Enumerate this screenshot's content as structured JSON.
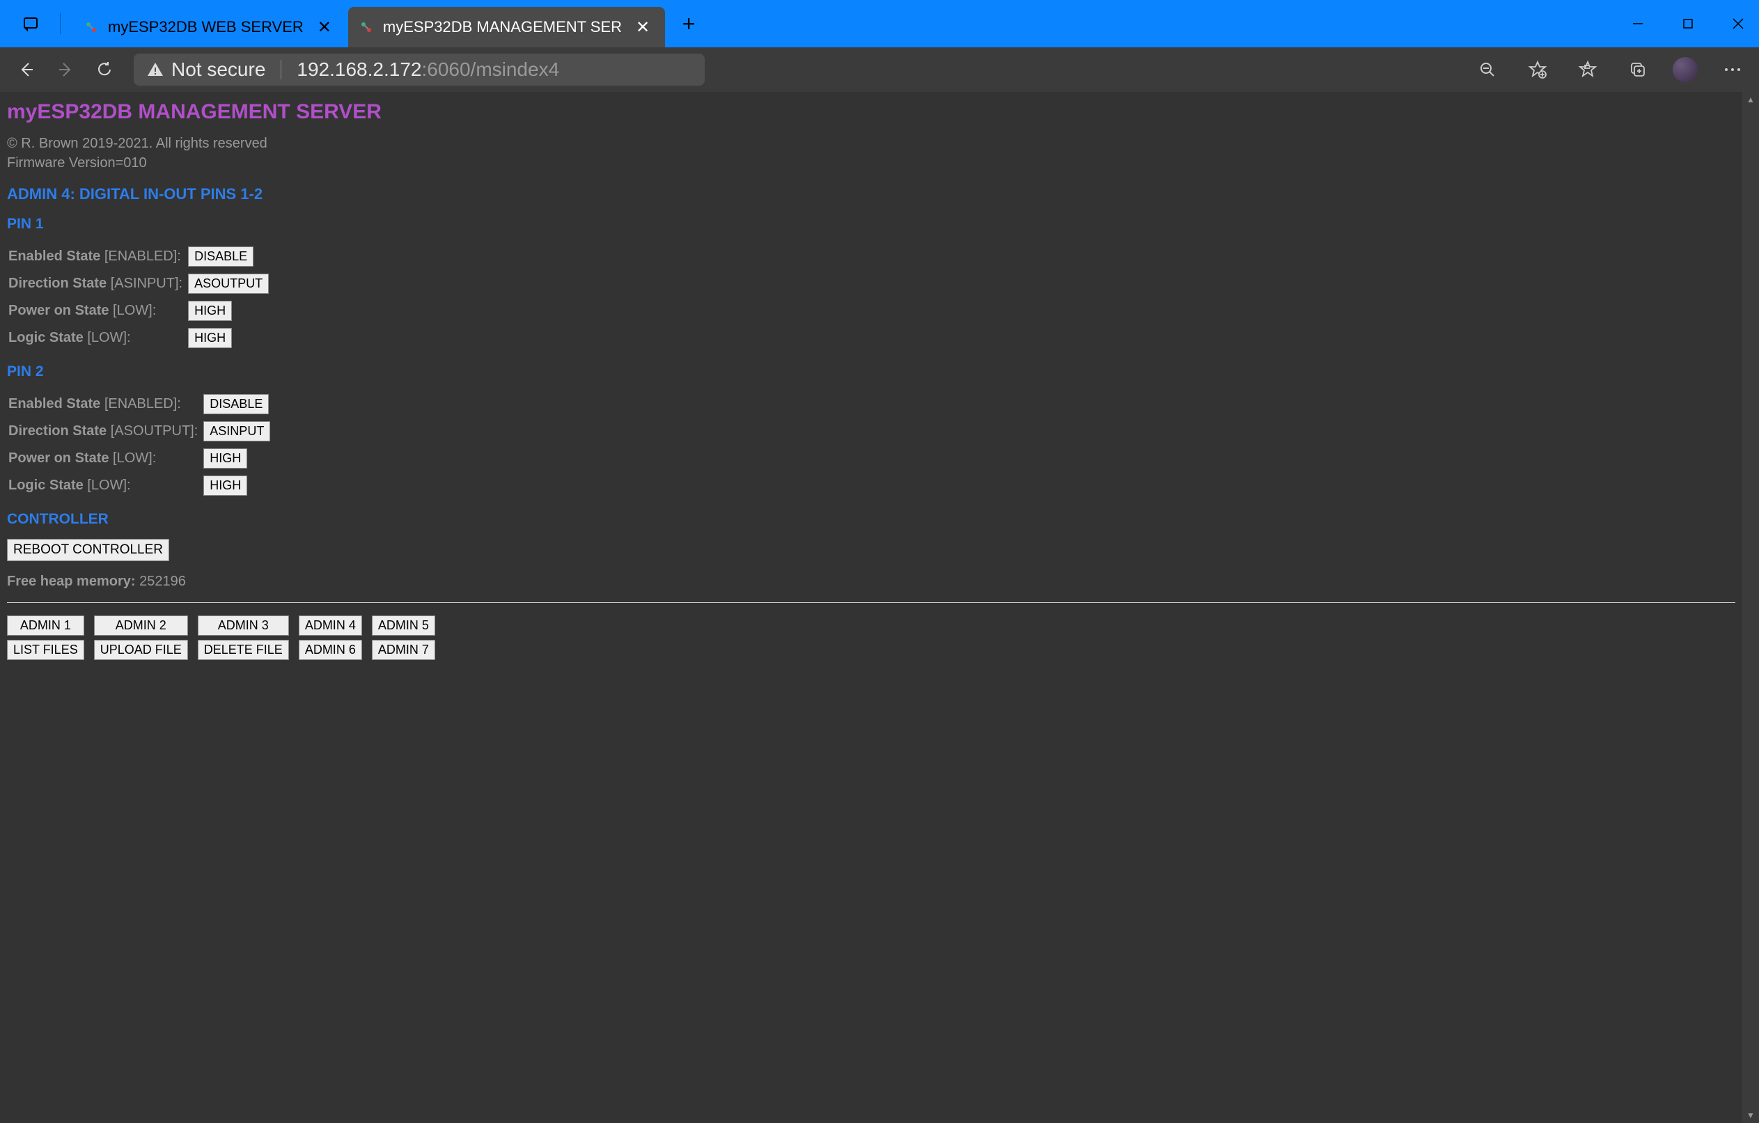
{
  "tabs": [
    {
      "title": "myESP32DB WEB SERVER"
    },
    {
      "title": "myESP32DB MANAGEMENT SER"
    }
  ],
  "address": {
    "not_secure": "Not secure",
    "host": "192.168.2.172",
    "port_path": ":6060/msindex4"
  },
  "page": {
    "title": "myESP32DB MANAGEMENT SERVER",
    "copyright": "© R. Brown 2019-2021. All rights reserved",
    "firmware": "Firmware Version=010",
    "section_title": "ADMIN 4: DIGITAL IN-OUT PINS 1-2",
    "pin1_title": "PIN 1",
    "pin2_title": "PIN 2",
    "controller_title": "CONTROLLER",
    "labels": {
      "enabled": "Enabled State",
      "direction": "Direction State",
      "poweron": "Power on State",
      "logic": "Logic State"
    },
    "pin1": {
      "enabled_val": "[ENABLED]:",
      "enabled_btn": "DISABLE",
      "direction_val": "[ASINPUT]:",
      "direction_btn": "ASOUTPUT",
      "poweron_val": "[LOW]:",
      "poweron_btn": "HIGH",
      "logic_val": "[LOW]:",
      "logic_btn": "HIGH"
    },
    "pin2": {
      "enabled_val": "[ENABLED]:",
      "enabled_btn": "DISABLE",
      "direction_val": "[ASOUTPUT]:",
      "direction_btn": "ASINPUT",
      "poweron_val": "[LOW]:",
      "poweron_btn": "HIGH",
      "logic_val": "[LOW]:",
      "logic_btn": "HIGH"
    },
    "reboot_btn": "REBOOT CONTROLLER",
    "heap_label": "Free heap memory:",
    "heap_value": "252196",
    "admin_buttons_row1": [
      "ADMIN 1",
      "ADMIN 2",
      "ADMIN 3",
      "ADMIN 4",
      "ADMIN 5"
    ],
    "admin_buttons_row2": [
      "LIST FILES",
      "UPLOAD FILE",
      "DELETE FILE",
      "ADMIN 6",
      "ADMIN 7"
    ]
  }
}
